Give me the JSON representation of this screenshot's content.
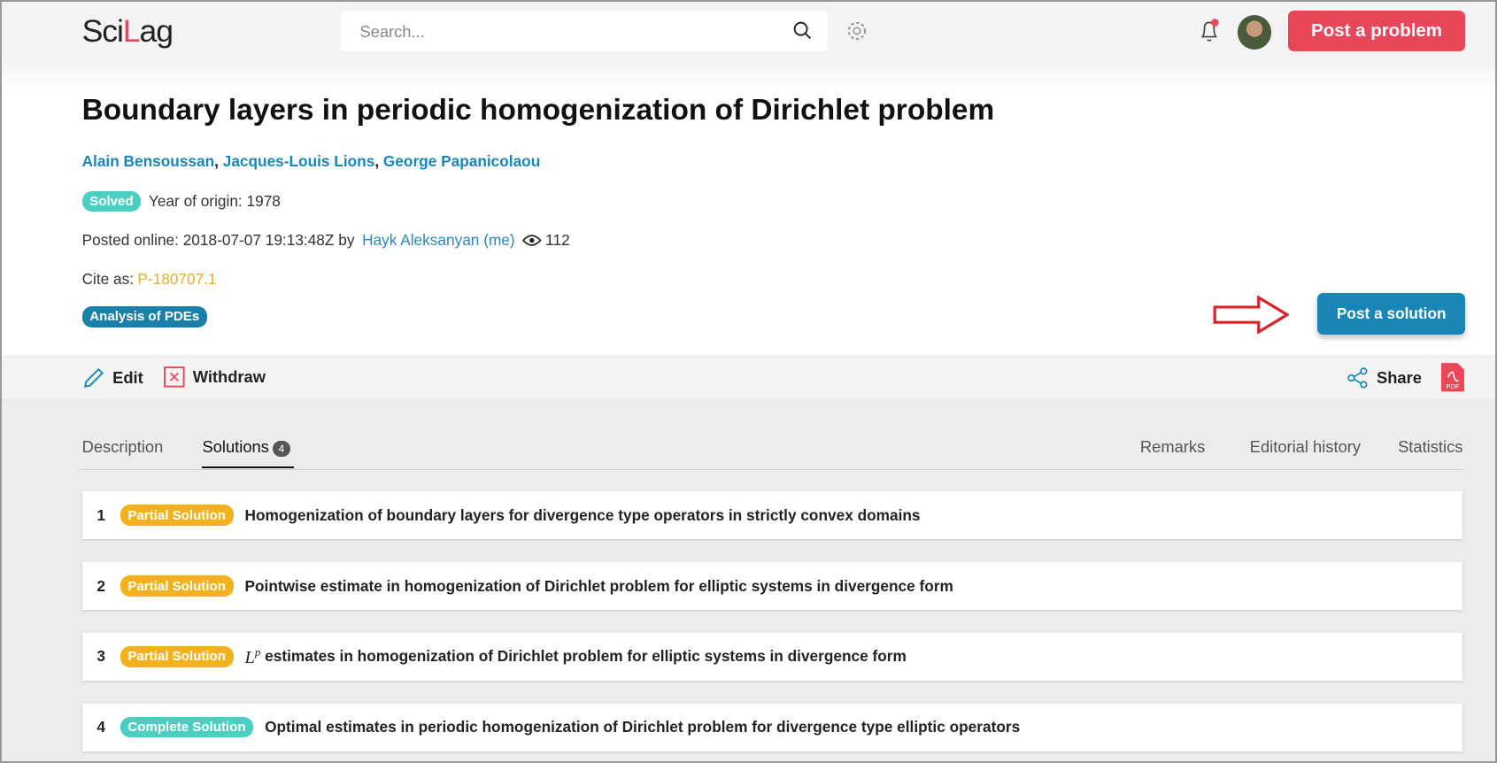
{
  "header": {
    "logo_a": "Sci",
    "logo_b": "L",
    "logo_c": "ag",
    "search_placeholder": "Search...",
    "post_problem": "Post a problem"
  },
  "problem": {
    "title": "Boundary layers in periodic homogenization of Dirichlet problem",
    "authors": [
      "Alain Bensoussan",
      "Jacques-Louis Lions",
      "George Papanicolaou"
    ],
    "status": "Solved",
    "year_label": "Year of origin: 1978",
    "posted_prefix": "Posted online: 2018-07-07 19:13:48Z by",
    "posted_by": "Hayk Aleksanyan (me)",
    "views": "112",
    "cite_label": "Cite as:",
    "cite_id": "P-180707.1",
    "tag": "Analysis of PDEs",
    "post_solution": "Post a solution"
  },
  "actions": {
    "edit": "Edit",
    "withdraw": "Withdraw",
    "share": "Share"
  },
  "tabs": {
    "description": "Description",
    "solutions": "Solutions",
    "solutions_count": "4",
    "remarks": "Remarks",
    "history": "Editorial history",
    "statistics": "Statistics"
  },
  "solutions": [
    {
      "num": "1",
      "type": "Partial Solution",
      "title": "Homogenization of boundary layers for divergence type operators in strictly convex domains"
    },
    {
      "num": "2",
      "type": "Partial Solution",
      "title": "Pointwise estimate in homogenization of Dirichlet problem for elliptic systems in divergence form"
    },
    {
      "num": "3",
      "type": "Partial Solution",
      "math": "L",
      "sup": "p",
      "title": " estimates in homogenization of Dirichlet problem for elliptic systems in divergence form"
    },
    {
      "num": "4",
      "type": "Complete Solution",
      "title": "Optimal estimates in periodic homogenization of Dirichlet problem for divergence type elliptic operators"
    }
  ],
  "colors": {
    "accent": "#1a86b5",
    "danger": "#e8475a",
    "partial": "#f2b21e",
    "complete": "#4ccfc0"
  }
}
